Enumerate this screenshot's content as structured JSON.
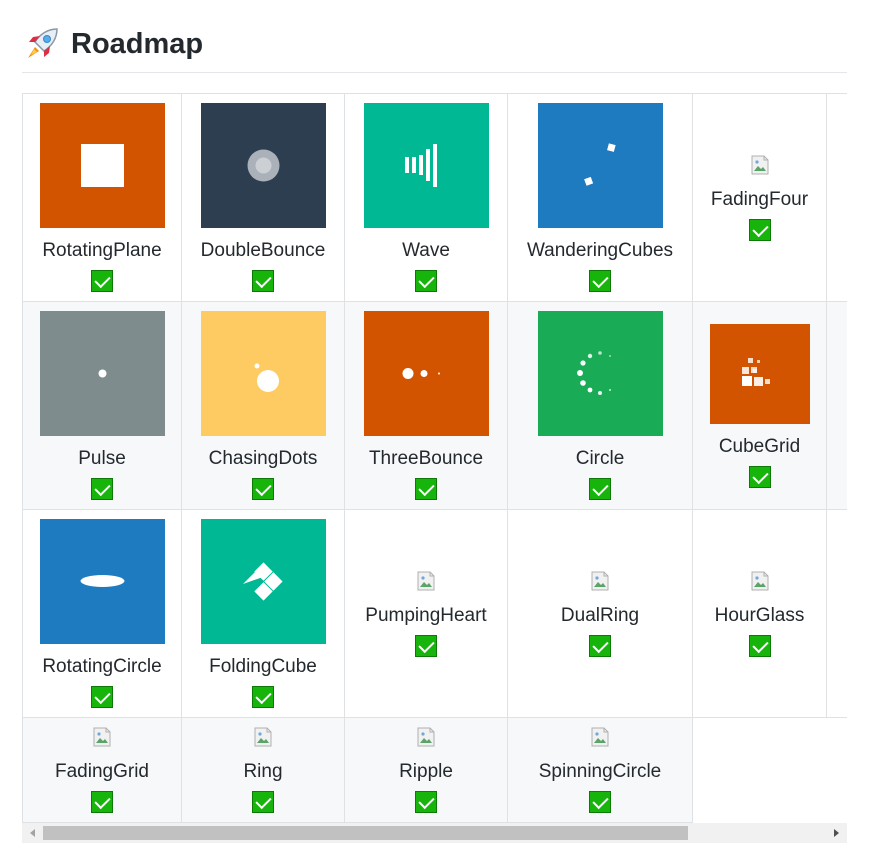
{
  "page": {
    "title": "Roadmap",
    "rocket_icon": "rocket-icon"
  },
  "colors": {
    "orange": "#d35400",
    "midnight": "#2c3e50",
    "turquoise": "#00b894",
    "blue": "#1e7bbf",
    "gray": "#7f8c8d",
    "yellow": "#fdcb62",
    "green": "#1aab57",
    "check_green": "#17b50c"
  },
  "rows": [
    [
      {
        "name": "RotatingPlane",
        "done": true,
        "preview": "rotating-plane"
      },
      {
        "name": "DoubleBounce",
        "done": true,
        "preview": "double-bounce"
      },
      {
        "name": "Wave",
        "done": true,
        "preview": "wave"
      },
      {
        "name": "WanderingCubes",
        "done": true,
        "preview": "wandering-cubes"
      },
      {
        "name": "FadingFour",
        "done": true,
        "preview": "broken-image"
      }
    ],
    [
      {
        "name": "Pulse",
        "done": true,
        "preview": "pulse"
      },
      {
        "name": "ChasingDots",
        "done": true,
        "preview": "chasing-dots"
      },
      {
        "name": "ThreeBounce",
        "done": true,
        "preview": "three-bounce"
      },
      {
        "name": "Circle",
        "done": true,
        "preview": "circle"
      },
      {
        "name": "CubeGrid",
        "done": true,
        "preview": "cube-grid"
      }
    ],
    [
      {
        "name": "RotatingCircle",
        "done": true,
        "preview": "rotating-circle"
      },
      {
        "name": "FoldingCube",
        "done": true,
        "preview": "folding-cube"
      },
      {
        "name": "PumpingHeart",
        "done": true,
        "preview": "broken-image"
      },
      {
        "name": "DualRing",
        "done": true,
        "preview": "broken-image"
      },
      {
        "name": "HourGlass",
        "done": true,
        "preview": "broken-image"
      }
    ],
    [
      {
        "name": "FadingGrid",
        "done": true,
        "preview": "broken-image"
      },
      {
        "name": "Ring",
        "done": true,
        "preview": "broken-image"
      },
      {
        "name": "Ripple",
        "done": true,
        "preview": "broken-image"
      },
      {
        "name": "SpinningCircle",
        "done": true,
        "preview": "broken-image"
      }
    ]
  ]
}
